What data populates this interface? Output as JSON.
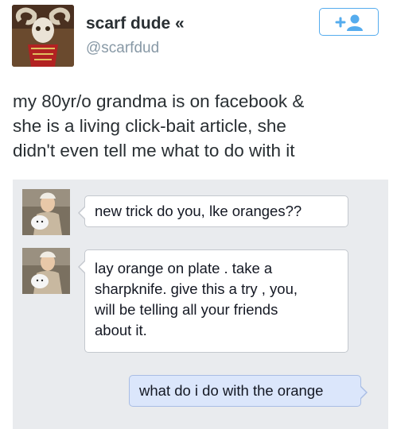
{
  "tweet": {
    "display_name": "scarf dude «",
    "handle": "@scarfdud",
    "follow_icon": "add-user-icon",
    "text_lines": [
      "my 80yr/o grandma is on facebook &",
      "she is a living click-bait article, she",
      "didn't even tell me what to do with it"
    ]
  },
  "chat": {
    "messages": [
      {
        "direction": "incoming",
        "lines": [
          "new trick do you, lke oranges??"
        ]
      },
      {
        "direction": "incoming",
        "lines": [
          "lay orange on plate . take a",
          "sharpknife. give this a try , you,",
          "will be telling all your friends",
          "about it."
        ]
      },
      {
        "direction": "outgoing",
        "lines": [
          "what do i do with the orange"
        ]
      }
    ]
  },
  "colors": {
    "link_blue": "#55acee",
    "handle_gray": "#8899a6",
    "chat_background": "#e9ebee",
    "outgoing_bubble": "#dbe6fb"
  }
}
